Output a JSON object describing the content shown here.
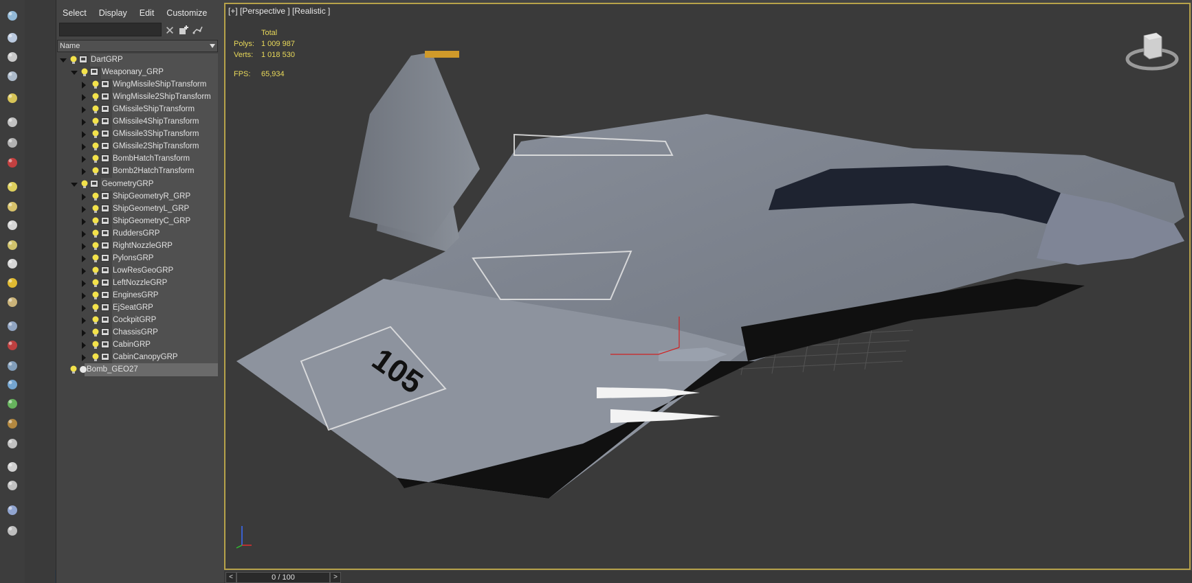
{
  "menu": [
    "Select",
    "Display",
    "Edit",
    "Customize"
  ],
  "explorer": {
    "find_placeholder": "",
    "column_header": "Name",
    "rows": [
      {
        "label": "DartGRP",
        "level": 0,
        "expanded": true,
        "icon": "layer-icon"
      },
      {
        "label": "Weaponary_GRP",
        "level": 1,
        "expanded": true,
        "icon": "layer-icon"
      },
      {
        "label": "WingMissileShipTransform",
        "level": 2,
        "expanded": false,
        "icon": "layer-icon"
      },
      {
        "label": "WingMissile2ShipTransform",
        "level": 2,
        "expanded": false,
        "icon": "layer-icon"
      },
      {
        "label": "GMissileShipTransform",
        "level": 2,
        "expanded": false,
        "icon": "layer-icon"
      },
      {
        "label": "GMissile4ShipTransform",
        "level": 2,
        "expanded": false,
        "icon": "layer-icon"
      },
      {
        "label": "GMissile3ShipTransform",
        "level": 2,
        "expanded": false,
        "icon": "layer-icon"
      },
      {
        "label": "GMissile2ShipTransform",
        "level": 2,
        "expanded": false,
        "icon": "layer-icon"
      },
      {
        "label": "BombHatchTransform",
        "level": 2,
        "expanded": false,
        "icon": "layer-icon"
      },
      {
        "label": "Bomb2HatchTransform",
        "level": 2,
        "expanded": false,
        "icon": "layer-icon"
      },
      {
        "label": "GeometryGRP",
        "level": 1,
        "expanded": true,
        "icon": "layer-icon"
      },
      {
        "label": "ShipGeometryR_GRP",
        "level": 2,
        "expanded": false,
        "icon": "layer-icon"
      },
      {
        "label": "ShipGeometryL_GRP",
        "level": 2,
        "expanded": false,
        "icon": "layer-icon"
      },
      {
        "label": "ShipGeometryC_GRP",
        "level": 2,
        "expanded": false,
        "icon": "layer-icon"
      },
      {
        "label": "RuddersGRP",
        "level": 2,
        "expanded": false,
        "icon": "layer-icon"
      },
      {
        "label": "RightNozzleGRP",
        "level": 2,
        "expanded": false,
        "icon": "layer-icon"
      },
      {
        "label": "PylonsGRP",
        "level": 2,
        "expanded": false,
        "icon": "layer-icon"
      },
      {
        "label": "LowResGeoGRP",
        "level": 2,
        "expanded": false,
        "icon": "layer-icon"
      },
      {
        "label": "LeftNozzleGRP",
        "level": 2,
        "expanded": false,
        "icon": "layer-icon"
      },
      {
        "label": "EnginesGRP",
        "level": 2,
        "expanded": false,
        "icon": "layer-icon"
      },
      {
        "label": "EjSeatGRP",
        "level": 2,
        "expanded": false,
        "icon": "layer-icon"
      },
      {
        "label": "CockpitGRP",
        "level": 2,
        "expanded": false,
        "icon": "layer-icon"
      },
      {
        "label": "ChassisGRP",
        "level": 2,
        "expanded": false,
        "icon": "layer-icon"
      },
      {
        "label": "CabinGRP",
        "level": 2,
        "expanded": false,
        "icon": "layer-icon"
      },
      {
        "label": "CabinCanopyGRP",
        "level": 2,
        "expanded": false,
        "icon": "layer-icon"
      },
      {
        "label": "Bomb_GEO27",
        "level": 0,
        "leaf": true,
        "selected": true,
        "icon": "sphere-object-icon"
      }
    ]
  },
  "viewport": {
    "label": "[+] [Perspective ] [Realistic ]",
    "stats": {
      "header": "Total",
      "polys_label": "Polys:",
      "polys": "1 009 987",
      "verts_label": "Verts:",
      "verts": "1 018 530",
      "fps_label": "FPS:",
      "fps": "65,934"
    },
    "hull_number": "105",
    "tail_number": "105"
  },
  "timeline": {
    "value": "0 / 100",
    "prev": "<",
    "next": ">"
  },
  "toolbar_icons": [
    "teapot-icon",
    "render-frame-icon",
    "render-setup-icon",
    "material-editor-icon",
    "light-lister-icon",
    "camera-icon",
    "half-sphere-icon",
    "viewport-camera-icon",
    "plane-icon",
    "dome-icon",
    "circle-icon",
    "teapot-icon",
    "cone-icon",
    "sun-icon",
    "sphere-icon",
    "particles-icon",
    "molecule-icon",
    "bone-icon",
    "gear-icon",
    "grass-icon",
    "hair-fur-icon",
    "ox-icon",
    "sphere-material-icon",
    "compose-icon",
    "scene-states-icon",
    "help-icon"
  ],
  "colors": {
    "viewport_border": "#b8a34a",
    "stats_text": "#e9d95a",
    "bulb": "#f3e24b",
    "panel": "#444444"
  }
}
